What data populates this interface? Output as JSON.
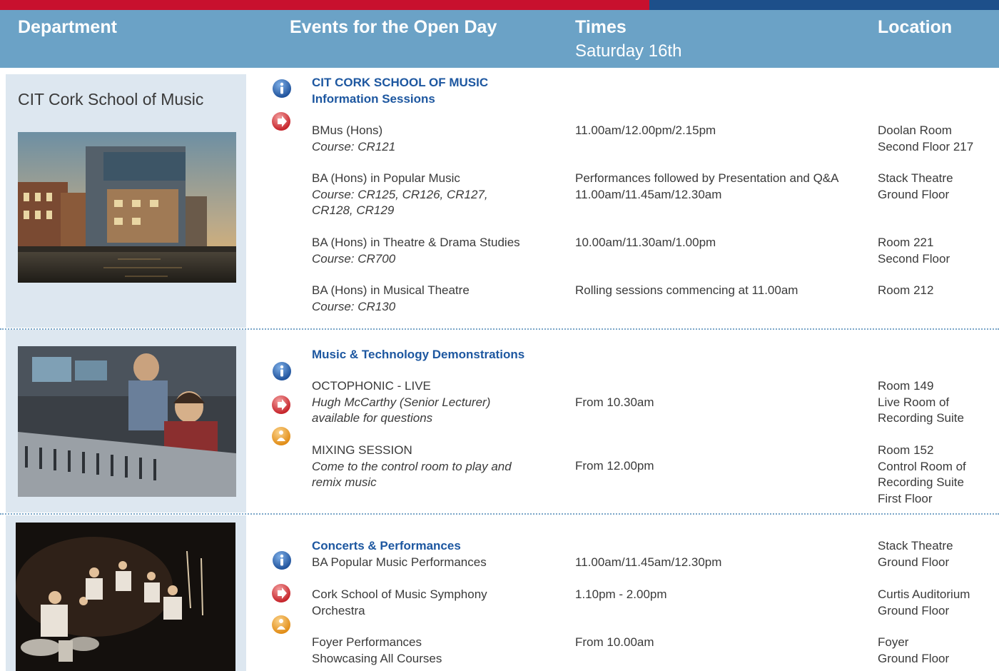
{
  "header": {
    "department": "Department",
    "events": "Events for the Open Day",
    "times": "Times",
    "times_sub": "Saturday 16th",
    "location": "Location"
  },
  "department": {
    "name": "CIT Cork School of Music"
  },
  "sections": {
    "info": {
      "heading_line1": "CIT CORK SCHOOL OF MUSIC",
      "heading_line2": "Information Sessions",
      "rows": [
        {
          "event": "BMus (Hons)",
          "course": "Course: CR121",
          "time": "11.00am/12.00pm/2.15pm",
          "location": [
            "Doolan Room",
            "Second Floor 217"
          ]
        },
        {
          "event": "BA (Hons) in Popular Music",
          "course": "Course: CR125, CR126, CR127,",
          "course2": "CR128, CR129",
          "time": "Performances followed by Presentation and Q&A",
          "time2": "11.00am/11.45am/12.30am",
          "location": [
            "Stack Theatre",
            "Ground Floor"
          ]
        },
        {
          "event": "BA (Hons) in Theatre & Drama Studies",
          "course": "Course: CR700",
          "time": "10.00am/11.30am/1.00pm",
          "location": [
            "Room 221",
            "Second Floor"
          ]
        },
        {
          "event": "BA (Hons) in Musical Theatre",
          "course": "Course: CR130",
          "time": "Rolling sessions commencing at 11.00am",
          "location": [
            "Room 212"
          ]
        }
      ]
    },
    "tech": {
      "heading": "Music & Technology Demonstrations",
      "rows": [
        {
          "event": "OCTOPHONIC - LIVE",
          "note1": "Hugh McCarthy (Senior Lecturer)",
          "note2": "available for questions",
          "time": "From 10.30am",
          "location": [
            "Room 149",
            "Live Room of",
            "Recording Suite"
          ]
        },
        {
          "event": "MIXING SESSION",
          "note1": "Come to the control room to play and",
          "note2": "remix music",
          "time": "From 12.00pm",
          "location": [
            "Room 152",
            "Control Room of",
            "Recording Suite",
            "First Floor"
          ]
        }
      ]
    },
    "concerts": {
      "heading": "Concerts & Performances",
      "rows": [
        {
          "event": "BA Popular Music Performances",
          "time": "11.00am/11.45am/12.30pm",
          "location": [
            "Stack Theatre",
            "Ground Floor"
          ]
        },
        {
          "event": "Cork School of Music Symphony",
          "event2": "Orchestra",
          "time": "1.10pm - 2.00pm",
          "location": [
            "Curtis Auditorium",
            "Ground Floor"
          ]
        },
        {
          "event": "Foyer Performances",
          "event2": "Showcasing All Courses",
          "time": "From 10.00am",
          "location": [
            "Foyer",
            "Ground Floor"
          ]
        }
      ]
    }
  },
  "icons": [
    "info-icon",
    "arrow-icon",
    "person-icon"
  ],
  "colors": {
    "red": "#c8102e",
    "navy": "#1d4f8a",
    "header": "#6ba2c6",
    "panel": "#dde7f0",
    "heading": "#1d57a0"
  }
}
